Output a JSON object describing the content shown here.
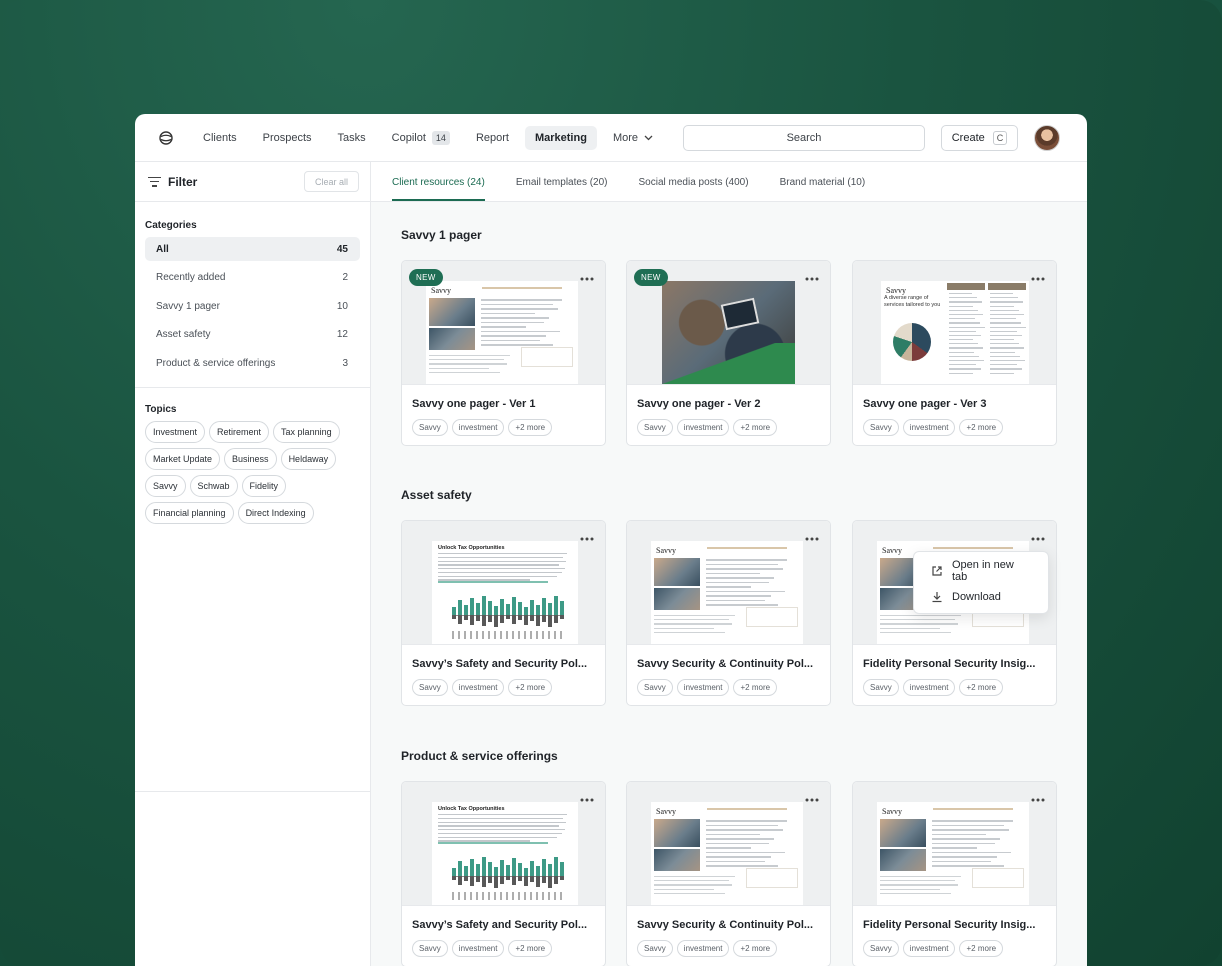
{
  "nav": {
    "items": [
      {
        "label": "Clients"
      },
      {
        "label": "Prospects"
      },
      {
        "label": "Tasks"
      },
      {
        "label": "Copilot",
        "badge": "14"
      },
      {
        "label": "Report"
      },
      {
        "label": "Marketing",
        "active": true
      },
      {
        "label": "More"
      }
    ],
    "search_label": "Search",
    "create_label": "Create",
    "create_shortcut": "C"
  },
  "sidebar": {
    "filter_label": "Filter",
    "clear_label": "Clear all",
    "categories_title": "Categories",
    "categories": [
      {
        "label": "All",
        "count": "45",
        "active": true
      },
      {
        "label": "Recently added",
        "count": "2"
      },
      {
        "label": "Savvy 1 pager",
        "count": "10"
      },
      {
        "label": "Asset safety",
        "count": "12"
      },
      {
        "label": "Product & service offerings",
        "count": "3"
      }
    ],
    "topics_title": "Topics",
    "topics": [
      "Investment",
      "Retirement",
      "Tax planning",
      "Market Update",
      "Business",
      "Heldaway",
      "Savvy",
      "Schwab",
      "Fidelity",
      "Financial planning",
      "Direct Indexing"
    ]
  },
  "tabs": [
    {
      "label": "Client resources (24)",
      "active": true
    },
    {
      "label": "Email templates (20)"
    },
    {
      "label": "Social media posts (400)"
    },
    {
      "label": "Brand material (10)"
    }
  ],
  "groups": [
    {
      "title": "Savvy 1 pager",
      "cards": [
        {
          "title": "Savvy one pager - Ver 1",
          "new": "NEW",
          "thumb": "doc",
          "tags": [
            "Savvy",
            "investment",
            "+2 more"
          ]
        },
        {
          "title": "Savvy one pager - Ver 2",
          "new": "NEW",
          "thumb": "photo",
          "tags": [
            "Savvy",
            "investment",
            "+2 more"
          ]
        },
        {
          "title": "Savvy one pager - Ver 3",
          "thumb": "pie",
          "tags": [
            "Savvy",
            "investment",
            "+2 more"
          ]
        }
      ]
    },
    {
      "title": "Asset safety",
      "cards": [
        {
          "title": "Savvy’s Safety and Security Pol...",
          "thumb": "chart",
          "tags": [
            "Savvy",
            "investment",
            "+2 more"
          ]
        },
        {
          "title": "Savvy Security & Continuity Pol...",
          "thumb": "doc",
          "tags": [
            "Savvy",
            "investment",
            "+2 more"
          ]
        },
        {
          "title": "Fidelity Personal Security Insig...",
          "thumb": "doc",
          "tags": [
            "Savvy",
            "investment",
            "+2 more"
          ]
        }
      ]
    },
    {
      "title": "Product & service offerings",
      "cards": [
        {
          "title": "Savvy’s Safety and Security Pol...",
          "thumb": "chart",
          "tags": [
            "Savvy",
            "investment",
            "+2 more"
          ]
        },
        {
          "title": "Savvy Security & Continuity Pol...",
          "thumb": "doc",
          "tags": [
            "Savvy",
            "investment",
            "+2 more"
          ]
        },
        {
          "title": "Fidelity Personal Security Insig...",
          "thumb": "doc",
          "tags": [
            "Savvy",
            "investment",
            "+2 more"
          ]
        }
      ]
    }
  ],
  "thumb_text": {
    "brand": "Savvy",
    "pie_heading": "A diverse range of services tailored to you",
    "chart_heading": "Unlock Tax Opportunities"
  },
  "menu": {
    "items": [
      {
        "label": "Open in new tab",
        "icon": "external-link-icon"
      },
      {
        "label": "Download",
        "icon": "download-icon"
      }
    ]
  },
  "colors": {
    "accent": "#1c6b52",
    "new_badge": "#1f6e54",
    "background": "#17503d"
  }
}
